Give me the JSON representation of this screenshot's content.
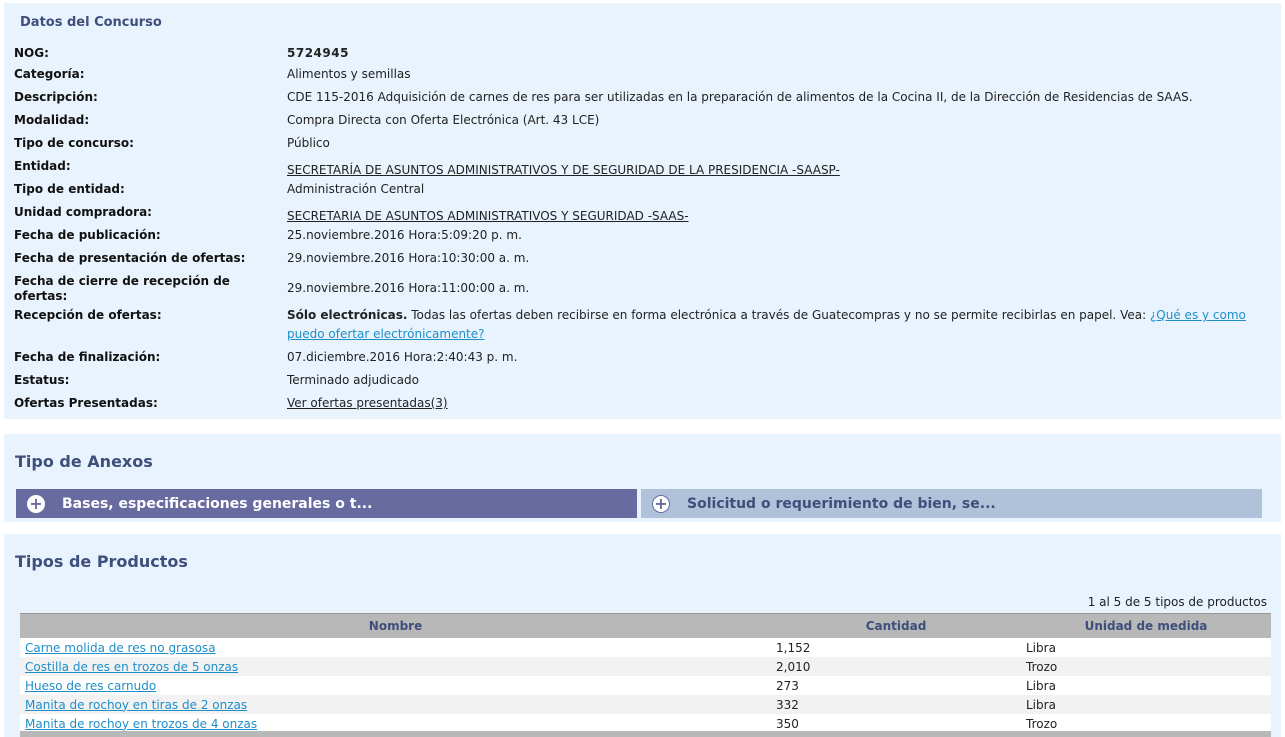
{
  "datos": {
    "title": "Datos del Concurso",
    "rows": [
      {
        "label": "NOG:",
        "value": "5724945"
      },
      {
        "label": "Categoría:",
        "value": "Alimentos y semillas"
      },
      {
        "label": "Descripción:",
        "value": "CDE 115-2016 Adquisición de carnes de res para ser utilizadas en la preparación de alimentos de la Cocina II, de la Dirección de Residencias de SAAS."
      },
      {
        "label": "Modalidad:",
        "value": "Compra Directa con Oferta Electrónica (Art. 43 LCE)"
      },
      {
        "label": "Tipo de concurso:",
        "value": "Público"
      },
      {
        "label": "Entidad:",
        "value": "SECRETARÍA DE ASUNTOS ADMINISTRATIVOS Y DE SEGURIDAD DE LA PRESIDENCIA -SAASP-"
      },
      {
        "label": "Tipo de entidad:",
        "value": "Administración Central"
      },
      {
        "label": "Unidad compradora:",
        "value": "SECRETARIA DE ASUNTOS ADMINISTRATIVOS Y SEGURIDAD -SAAS-"
      },
      {
        "label": "Fecha de publicación:",
        "value": "25.noviembre.2016 Hora:5:09:20 p. m."
      },
      {
        "label": "Fecha de presentación de ofertas:",
        "value": "29.noviembre.2016 Hora:10:30:00 a. m."
      },
      {
        "label": "Fecha de cierre de recepción de ofertas:",
        "value": "29.noviembre.2016 Hora:11:00:00 a. m."
      },
      {
        "label": "Recepción de ofertas:",
        "value_bold": "Sólo electrónicas.",
        "value_text": " Todas las ofertas deben recibirse en forma electrónica a través de Guatecompras y no se permite recibirlas en papel. Vea: ",
        "value_link": "¿Qué es y como puedo ofertar electrónicamente?"
      },
      {
        "label": "Fecha de finalización:",
        "value": "07.diciembre.2016 Hora:2:40:43 p. m."
      },
      {
        "label": "Estatus:",
        "value": "Terminado adjudicado"
      },
      {
        "label": "Ofertas Presentadas:",
        "value": "Ver ofertas presentadas(3)"
      }
    ]
  },
  "anexos": {
    "title": "Tipo de Anexos",
    "tabs": [
      {
        "label": "Bases, especificaciones generales o t...",
        "icon": "plus-circle-icon",
        "active": true
      },
      {
        "label": "Solicitud o requerimiento de bien, se...",
        "icon": "plus-circle-icon",
        "active": false
      }
    ]
  },
  "productos": {
    "title": "Tipos de Productos",
    "pager": "1 al 5 de 5 tipos de productos",
    "columns": [
      "Nombre",
      "Cantidad",
      "Unidad de medida"
    ],
    "rows": [
      {
        "nombre": "Carne molida de res no grasosa",
        "cantidad": "1,152",
        "unidad": "Libra"
      },
      {
        "nombre": "Costilla de res en trozos de 5 onzas",
        "cantidad": "2,010",
        "unidad": "Trozo"
      },
      {
        "nombre": "Hueso de res carnudo",
        "cantidad": "273",
        "unidad": "Libra"
      },
      {
        "nombre": "Manita de rochoy en tiras de 2 onzas",
        "cantidad": "332",
        "unidad": "Libra"
      },
      {
        "nombre": "Manita de rochoy en trozos de 4 onzas",
        "cantidad": "350",
        "unidad": "Trozo"
      }
    ]
  },
  "colors": {
    "panel_bg": "#e8f3fd",
    "title_color": "#3d4f7a",
    "link_color": "#1f8ec8",
    "tab_active_bg": "#676b9f",
    "tab_inactive_bg": "#b0c1da",
    "table_header_bg": "#b8b8b8"
  }
}
